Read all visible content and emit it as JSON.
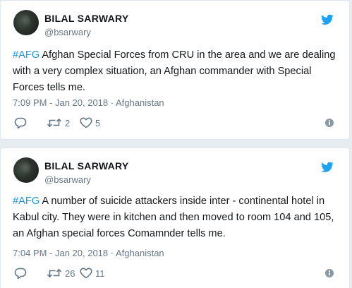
{
  "tweets": [
    {
      "author_name": "BILAL SARWARY",
      "handle": "@bsarwary",
      "hashtag": "#AFG",
      "body": " Afghan Special Forces from CRU in the area and we are dealing with a very complex situation, an Afghan commander with Special Forces tells me.",
      "timestamp": "7:09 PM - Jan 20, 2018",
      "separator": " · ",
      "location": "Afghanistan",
      "retweets": "2",
      "likes": "5"
    },
    {
      "author_name": "BILAL SARWARY",
      "handle": "@bsarwary",
      "hashtag": "#AFG",
      "body": " A number of suicide attackers inside inter - continental hotel in Kabul city. They were in kitchen and then moved to room 104 and 105, an Afghan special forces Comamnder tells me.",
      "timestamp": "7:04 PM - Jan 20, 2018",
      "separator": " · ",
      "location": "Afghanistan",
      "retweets": "26",
      "likes": "11"
    }
  ],
  "icons": {
    "brand": "twitter-bird-icon",
    "reply": "reply-icon",
    "retweet": "retweet-icon",
    "like": "heart-icon",
    "info": "info-icon"
  },
  "colors": {
    "brand_blue": "#1da1f2",
    "hashtag": "#1b95e0",
    "muted": "#657786",
    "background": "#e6ecf0"
  }
}
